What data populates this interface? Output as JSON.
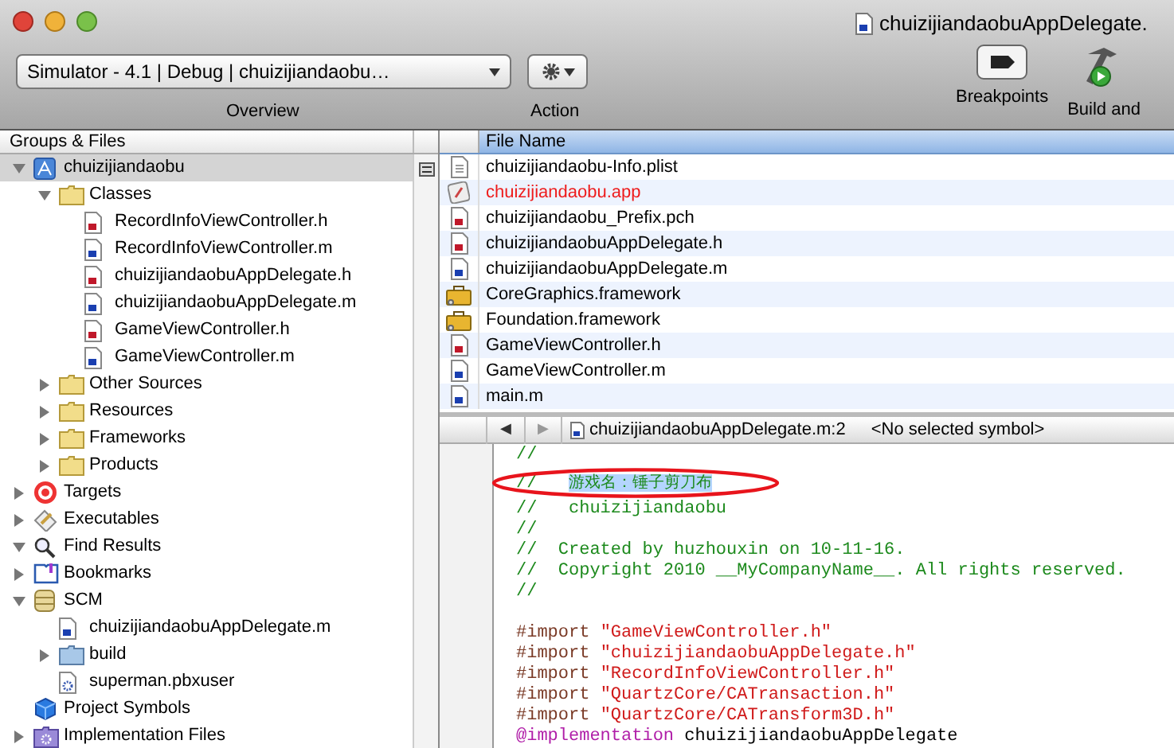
{
  "window": {
    "title": "chuizijiandaobuAppDelegate."
  },
  "toolbar": {
    "scheme": "Simulator - 4.1 | Debug | chuizijiandaobu…",
    "overview_label": "Overview",
    "action_label": "Action",
    "items": [
      {
        "kind": "breakpoints",
        "label": "Breakpoints"
      },
      {
        "kind": "build",
        "label": "Build and"
      }
    ]
  },
  "sidebar": {
    "header": "Groups & Files",
    "tree": [
      {
        "kind": "project",
        "label": "chuizijiandaobu",
        "selected": true,
        "expanded": true,
        "children": [
          {
            "kind": "folder",
            "label": "Classes",
            "selected": false,
            "expanded": true,
            "children": [
              {
                "kind": "h",
                "label": "RecordInfoViewController.h",
                "selected": false
              },
              {
                "kind": "m",
                "label": "RecordInfoViewController.m",
                "selected": false
              },
              {
                "kind": "h",
                "label": "chuizijiandaobuAppDelegate.h",
                "selected": false
              },
              {
                "kind": "m",
                "label": "chuizijiandaobuAppDelegate.m",
                "selected": false
              },
              {
                "kind": "h",
                "label": "GameViewController.h",
                "selected": false
              },
              {
                "kind": "m",
                "label": "GameViewController.m",
                "selected": false
              }
            ]
          },
          {
            "kind": "folder",
            "label": "Other Sources",
            "selected": false,
            "expanded": false
          },
          {
            "kind": "folder",
            "label": "Resources",
            "selected": false,
            "expanded": false
          },
          {
            "kind": "folder",
            "label": "Frameworks",
            "selected": false,
            "expanded": false
          },
          {
            "kind": "folder",
            "label": "Products",
            "selected": false,
            "expanded": false
          }
        ]
      },
      {
        "kind": "target",
        "label": "Targets",
        "selected": false,
        "expanded": false
      },
      {
        "kind": "executable",
        "label": "Executables",
        "selected": false,
        "expanded": false
      },
      {
        "kind": "find",
        "label": "Find Results",
        "selected": false,
        "expanded": true
      },
      {
        "kind": "bookmarks",
        "label": "Bookmarks",
        "selected": false,
        "expanded": false
      },
      {
        "kind": "scm",
        "label": "SCM",
        "selected": false,
        "expanded": true,
        "children": [
          {
            "kind": "m",
            "label": "chuizijiandaobuAppDelegate.m",
            "selected": false
          },
          {
            "kind": "bluefolder",
            "label": "build",
            "selected": false,
            "expanded": false
          },
          {
            "kind": "pbxuser",
            "label": "superman.pbxuser",
            "selected": false
          }
        ]
      },
      {
        "kind": "symbols",
        "label": "Project Symbols",
        "selected": false
      },
      {
        "kind": "impl",
        "label": "Implementation Files",
        "selected": false,
        "expanded": false
      }
    ]
  },
  "file_list": {
    "column": "File Name",
    "rows": [
      {
        "kind": "plist",
        "name": "chuizijiandaobu-Info.plist",
        "missing": false
      },
      {
        "kind": "app",
        "name": "chuizijiandaobu.app",
        "missing": true
      },
      {
        "kind": "h",
        "name": "chuizijiandaobu_Prefix.pch",
        "missing": false
      },
      {
        "kind": "h",
        "name": "chuizijiandaobuAppDelegate.h",
        "missing": false
      },
      {
        "kind": "m",
        "name": "chuizijiandaobuAppDelegate.m",
        "missing": false
      },
      {
        "kind": "framework",
        "name": "CoreGraphics.framework",
        "missing": false
      },
      {
        "kind": "framework",
        "name": "Foundation.framework",
        "missing": false
      },
      {
        "kind": "h",
        "name": "GameViewController.h",
        "missing": false
      },
      {
        "kind": "m",
        "name": "GameViewController.m",
        "missing": false
      },
      {
        "kind": "m",
        "name": "main.m",
        "missing": false
      }
    ]
  },
  "editor": {
    "back": "◀",
    "forward": "▶",
    "file": "chuizijiandaobuAppDelegate.m:2",
    "symbol": "<No selected symbol>",
    "comment_lines": [
      [
        {
          "kind": "comment",
          "text": "//"
        }
      ],
      [
        {
          "kind": "comment",
          "text": "//   "
        },
        {
          "kind": "selected",
          "text": "游戏名：锤子剪刀布"
        }
      ],
      [
        {
          "kind": "comment",
          "text": "//   chuizijiandaobu"
        }
      ],
      [
        {
          "kind": "comment",
          "text": "//"
        }
      ],
      [
        {
          "kind": "comment",
          "text": "//  Created by huzhouxin on 10-11-16."
        }
      ],
      [
        {
          "kind": "comment",
          "text": "//  Copyright 2010 __MyCompanyName__. All rights reserved."
        }
      ],
      [
        {
          "kind": "comment",
          "text": "//"
        }
      ]
    ],
    "code_lines": [
      [
        {
          "kind": "directive",
          "text": "#import "
        },
        {
          "kind": "string",
          "text": "\"GameViewController.h\""
        }
      ],
      [
        {
          "kind": "directive",
          "text": "#import "
        },
        {
          "kind": "string",
          "text": "\"chuizijiandaobuAppDelegate.h\""
        }
      ],
      [
        {
          "kind": "directive",
          "text": "#import "
        },
        {
          "kind": "string",
          "text": "\"RecordInfoViewController.h\""
        }
      ],
      [
        {
          "kind": "directive",
          "text": "#import "
        },
        {
          "kind": "string",
          "text": "\"QuartzCore/CATransaction.h\""
        }
      ],
      [
        {
          "kind": "directive",
          "text": "#import "
        },
        {
          "kind": "string",
          "text": "\"QuartzCore/CATransform3D.h\""
        }
      ],
      [
        {
          "kind": "keyword",
          "text": "@implementation"
        },
        {
          "kind": "plain",
          "text": " chuizijiandaobuAppDelegate"
        }
      ]
    ]
  }
}
